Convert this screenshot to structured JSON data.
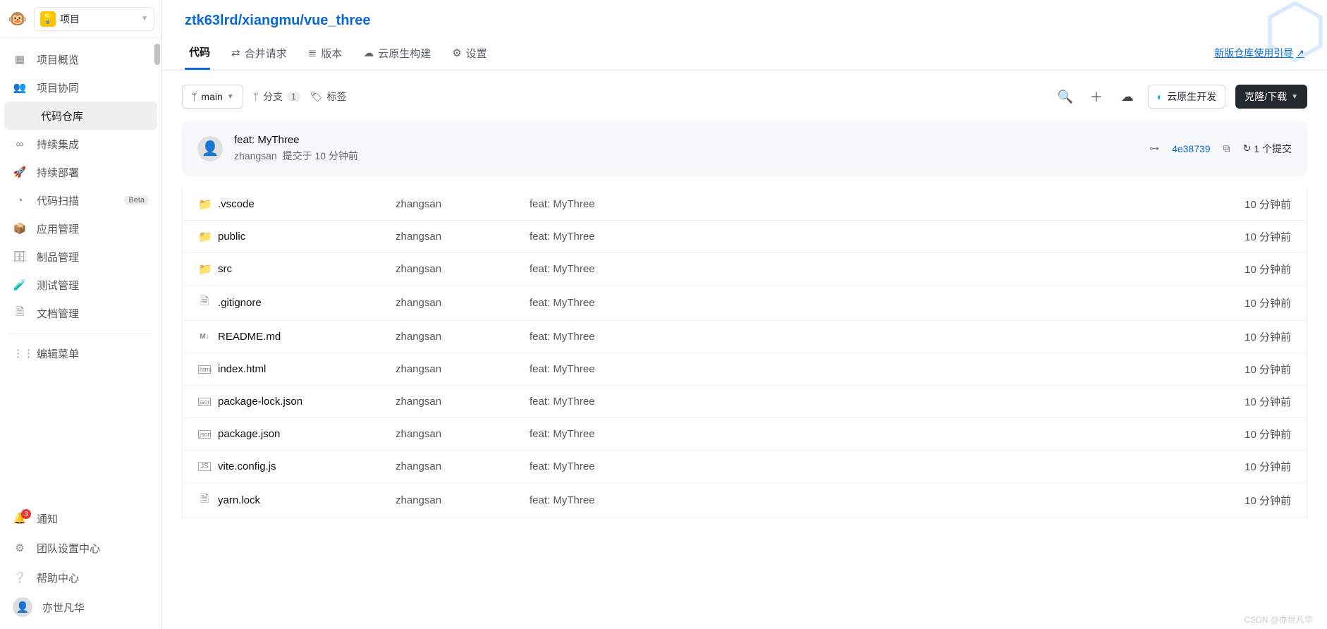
{
  "header": {
    "project_label": "项目"
  },
  "sidebar": {
    "items": [
      {
        "icon": "▦",
        "label": "项目概览"
      },
      {
        "icon": "👥",
        "label": "项目协同"
      },
      {
        "icon": "</>",
        "label": "代码仓库",
        "active": true
      },
      {
        "icon": "∞",
        "label": "持续集成"
      },
      {
        "icon": "🚀",
        "label": "持续部署"
      },
      {
        "icon": "◔",
        "label": "代码扫描",
        "badge": "Beta"
      },
      {
        "icon": "📦",
        "label": "应用管理"
      },
      {
        "icon": "🗄",
        "label": "制品管理"
      },
      {
        "icon": "🧪",
        "label": "测试管理"
      },
      {
        "icon": "🗎",
        "label": "文档管理"
      }
    ],
    "edit_menu": "编辑菜单",
    "bottom": [
      {
        "icon": "bell",
        "label": "通知"
      },
      {
        "icon": "gear",
        "label": "团队设置中心"
      },
      {
        "icon": "help",
        "label": "帮助中心"
      }
    ],
    "user": "亦世凡华"
  },
  "breadcrumb": {
    "p0": "ztk63lrd",
    "p1": "xiangmu",
    "p2": "vue_three"
  },
  "tabs": {
    "items": [
      {
        "icon": "</>",
        "label": "代码",
        "active": true
      },
      {
        "icon": "⇄",
        "label": "合并请求"
      },
      {
        "icon": "≣",
        "label": "版本"
      },
      {
        "icon": "☁",
        "label": "云原生构建"
      },
      {
        "icon": "⚙",
        "label": "设置"
      }
    ],
    "guide": "新版仓库使用引导"
  },
  "toolbar": {
    "branch": "main",
    "branch_label": "分支",
    "branch_count": "1",
    "tag_label": "标签",
    "cloud_btn": "云原生开发",
    "clone_btn": "克隆/下载"
  },
  "commit": {
    "title": "feat: MyThree",
    "author": "zhangsan",
    "time_prefix": "提交于",
    "time": "10 分钟前",
    "hash": "4e38739",
    "count_label": "1 个提交"
  },
  "files": [
    {
      "type": "folder",
      "name": ".vscode",
      "author": "zhangsan",
      "msg": "feat: MyThree",
      "time": "10 分钟前"
    },
    {
      "type": "folder",
      "name": "public",
      "author": "zhangsan",
      "msg": "feat: MyThree",
      "time": "10 分钟前"
    },
    {
      "type": "folder",
      "name": "src",
      "author": "zhangsan",
      "msg": "feat: MyThree",
      "time": "10 分钟前"
    },
    {
      "type": "file",
      "name": ".gitignore",
      "author": "zhangsan",
      "msg": "feat: MyThree",
      "time": "10 分钟前"
    },
    {
      "type": "md",
      "name": "README.md",
      "author": "zhangsan",
      "msg": "feat: MyThree",
      "time": "10 分钟前"
    },
    {
      "type": "html",
      "name": "index.html",
      "author": "zhangsan",
      "msg": "feat: MyThree",
      "time": "10 分钟前"
    },
    {
      "type": "json",
      "name": "package-lock.json",
      "author": "zhangsan",
      "msg": "feat: MyThree",
      "time": "10 分钟前"
    },
    {
      "type": "json",
      "name": "package.json",
      "author": "zhangsan",
      "msg": "feat: MyThree",
      "time": "10 分钟前"
    },
    {
      "type": "js",
      "name": "vite.config.js",
      "author": "zhangsan",
      "msg": "feat: MyThree",
      "time": "10 分钟前"
    },
    {
      "type": "file",
      "name": "yarn.lock",
      "author": "zhangsan",
      "msg": "feat: MyThree",
      "time": "10 分钟前"
    }
  ],
  "watermark": "CSDN @亦世凡华"
}
